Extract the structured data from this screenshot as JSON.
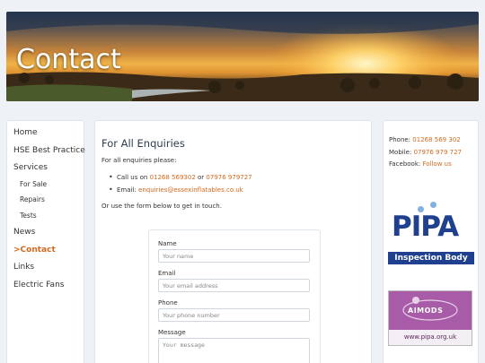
{
  "hero": {
    "title": "Contact"
  },
  "nav": {
    "items": [
      {
        "label": "Home",
        "sub": false,
        "active": false
      },
      {
        "label": "HSE Best Practice",
        "sub": false,
        "active": false
      },
      {
        "label": "Services",
        "sub": false,
        "active": false
      },
      {
        "label": "For Sale",
        "sub": true,
        "active": false
      },
      {
        "label": "Repairs",
        "sub": true,
        "active": false
      },
      {
        "label": "Tests",
        "sub": true,
        "active": false
      },
      {
        "label": "News",
        "sub": false,
        "active": false
      },
      {
        "label": ">Contact",
        "sub": false,
        "active": true
      },
      {
        "label": "Links",
        "sub": false,
        "active": false
      },
      {
        "label": "Electric Fans",
        "sub": false,
        "active": false
      }
    ]
  },
  "main": {
    "heading": "For All Enquiries",
    "intro": "For all enquiries please:",
    "call_prefix": "Call us on",
    "phone1": "01268 569302",
    "or": "or",
    "phone2": "07976 979727",
    "email_prefix": "Email:",
    "email": "enquiries@essexinflatables.co.uk",
    "form_note": "Or use the form below to get in touch."
  },
  "form": {
    "name_label": "Name",
    "name_placeholder": "Your name",
    "email_label": "Email",
    "email_placeholder": "Your email address",
    "phone_label": "Phone",
    "phone_placeholder": "Your phone number",
    "message_label": "Message",
    "message_placeholder": "Your message"
  },
  "sidebar": {
    "phone_label": "Phone:",
    "phone": "01268 569 302",
    "mobile_label": "Mobile:",
    "mobile": "07976 979 727",
    "facebook_label": "Facebook:",
    "facebook": "Follow us",
    "pipa_logo": "PIPA",
    "pipa_caption": "Inspection Body",
    "amods_logo": "AIMODS",
    "amods_caption": "www.pipa.org.uk"
  },
  "colors": {
    "accent": "#d2691e",
    "pipa_blue": "#1f3f8f",
    "amods_purple": "#a85ba6"
  }
}
